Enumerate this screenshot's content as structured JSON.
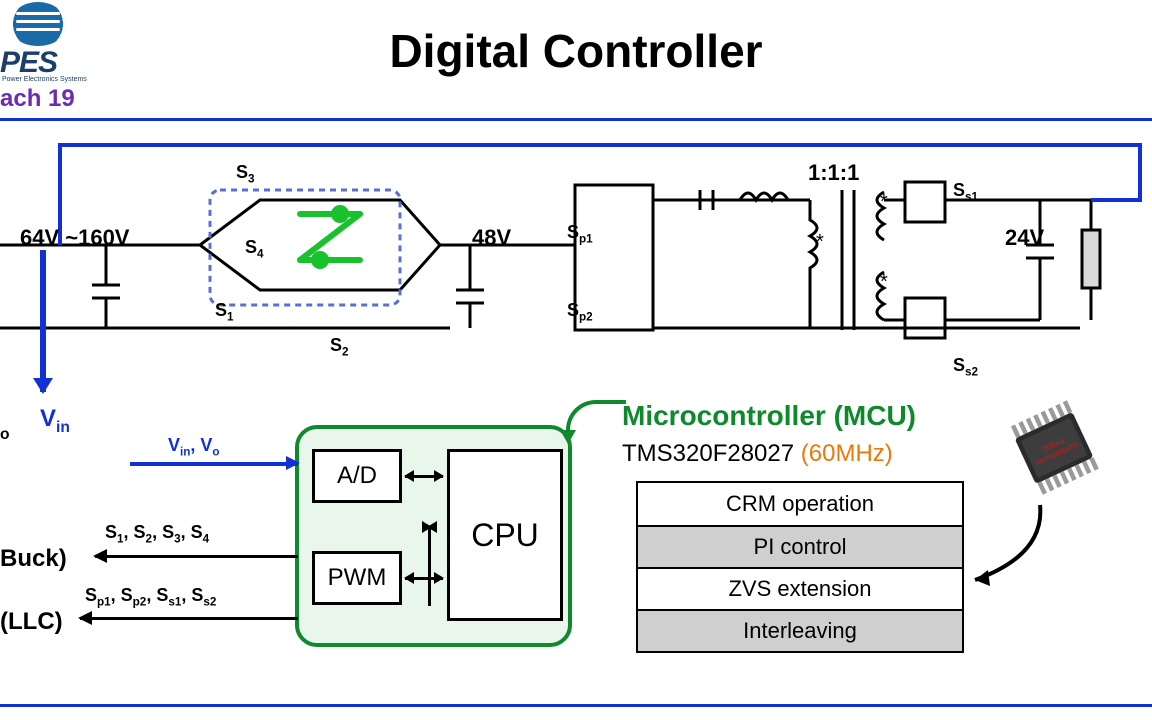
{
  "header": {
    "logo_label": "PES",
    "logo_sub": "Power Electronics Systems",
    "session": "ach 19"
  },
  "title": "Digital Controller",
  "circuit": {
    "vin_range": "64V ~160V",
    "bus_48": "48V",
    "out_24": "24V",
    "transformer_ratio": "1:1:1",
    "switches": {
      "s1": "S",
      "s1_sub": "1",
      "s2": "S",
      "s2_sub": "2",
      "s3": "S",
      "s3_sub": "3",
      "s4": "S",
      "s4_sub": "4",
      "sp1": "S",
      "sp1_sub": "p1",
      "sp2": "S",
      "sp2_sub": "p2",
      "ss1": "S",
      "ss1_sub": "s1",
      "ss2": "S",
      "ss2_sub": "s2"
    },
    "vin_label": "V",
    "vin_sub": "in",
    "vo_short": "o"
  },
  "signals": {
    "adc_in": "V<sub>in</sub>, V<sub>o</sub>",
    "adc_in_parts": [
      "V",
      "in",
      ", V",
      "o"
    ],
    "buck_gates": [
      "S",
      "1",
      ", S",
      "2",
      ", S",
      "3",
      ", S",
      "4"
    ],
    "llc_gates": [
      "S",
      "p1",
      ", S",
      "p2",
      ", S",
      "s1",
      ", S",
      "s2"
    ],
    "buck_label": "Buck)",
    "llc_label": "(LLC)"
  },
  "mcu": {
    "title": "Microcontroller (MCU)",
    "part": "TMS320F28027 ",
    "freq": "(60MHz)",
    "blocks": {
      "ad": "A/D",
      "pwm": "PWM",
      "cpu": "CPU"
    },
    "modes": [
      "CRM operation",
      "PI control",
      "ZVS extension",
      "Interleaving"
    ]
  }
}
